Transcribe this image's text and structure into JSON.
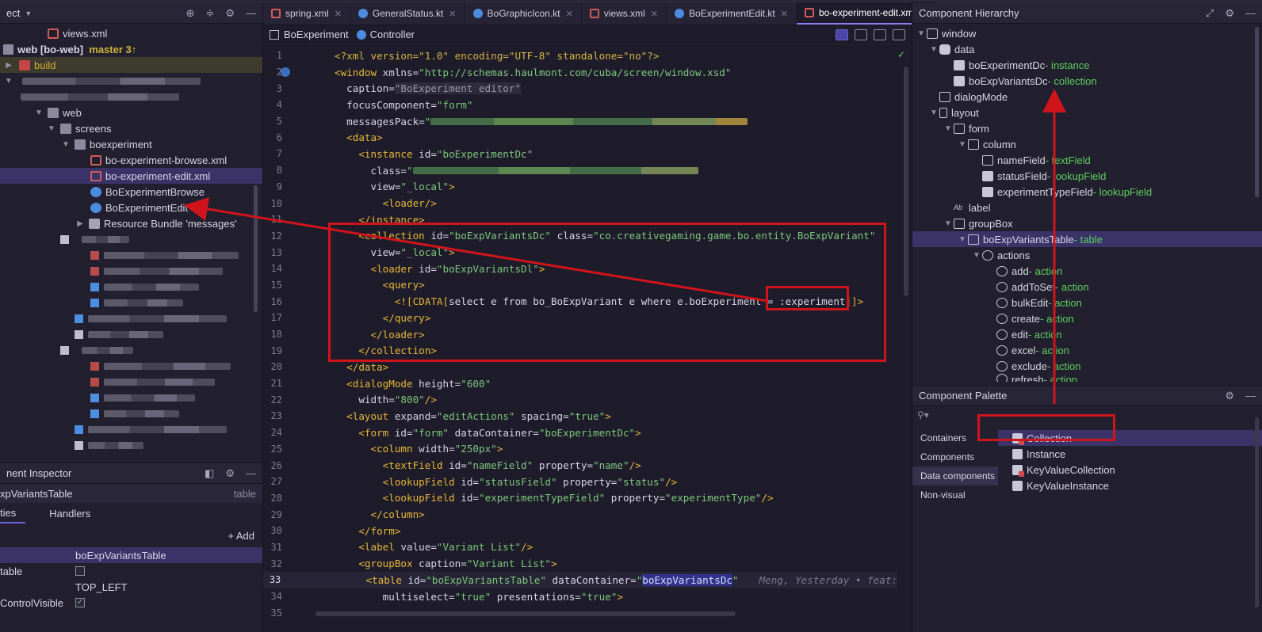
{
  "project": {
    "title": "ect",
    "items": [
      {
        "label": "views.xml",
        "type": "xml"
      },
      {
        "label": "web [bo-web]",
        "branch": "master 3↑"
      },
      {
        "label": "build"
      },
      {
        "label": "web"
      },
      {
        "label": "screens"
      },
      {
        "label": "boexperiment"
      },
      {
        "label": "bo-experiment-browse.xml"
      },
      {
        "label": "bo-experiment-edit.xml"
      },
      {
        "label": "BoExperimentBrowse"
      },
      {
        "label": "BoExperimentEdit"
      },
      {
        "label": "Resource Bundle 'messages'"
      }
    ]
  },
  "inspector": {
    "title": "nent Inspector",
    "component": "xpVariantsTable",
    "component_type": "table",
    "tabs": [
      "ties",
      "Handlers"
    ],
    "add_label": "+ Add",
    "props": [
      {
        "key": "",
        "value": "boExpVariantsTable"
      },
      {
        "key": "table",
        "value": ""
      },
      {
        "key": "",
        "value": "TOP_LEFT"
      },
      {
        "key": "ControlVisible",
        "value": ""
      }
    ]
  },
  "editor": {
    "tabs": [
      {
        "label": "spring.xml",
        "color": "#d05c5c"
      },
      {
        "label": "GeneralStatus.kt",
        "color": "#4d8be0"
      },
      {
        "label": "BoGraphicIcon.kt",
        "color": "#4d8be0"
      },
      {
        "label": "views.xml",
        "color": "#d05c5c"
      },
      {
        "label": "BoExperimentEdit.kt",
        "color": "#4d8be0"
      },
      {
        "label": "bo-experiment-edit.xml",
        "color": "#d05c5c"
      }
    ],
    "breadcrumb": {
      "screen": "BoExperiment",
      "controller": "Controller"
    },
    "annotation": "Meng, Yesterday • feat:",
    "highlight_word": "boExpVariantsDc",
    "lines": [
      {
        "n": "1"
      },
      {
        "n": "2"
      },
      {
        "n": "3"
      },
      {
        "n": "4"
      },
      {
        "n": "5"
      },
      {
        "n": "6"
      },
      {
        "n": "7"
      },
      {
        "n": "8"
      },
      {
        "n": "9"
      },
      {
        "n": "10"
      },
      {
        "n": "11"
      },
      {
        "n": "12"
      },
      {
        "n": "13"
      },
      {
        "n": "14"
      },
      {
        "n": "15"
      },
      {
        "n": "16"
      },
      {
        "n": "17"
      },
      {
        "n": "18"
      },
      {
        "n": "19"
      },
      {
        "n": "20"
      },
      {
        "n": "21"
      },
      {
        "n": "22"
      },
      {
        "n": "23"
      },
      {
        "n": "24"
      },
      {
        "n": "25"
      },
      {
        "n": "26"
      },
      {
        "n": "27"
      },
      {
        "n": "28"
      },
      {
        "n": "29"
      },
      {
        "n": "30"
      },
      {
        "n": "31"
      },
      {
        "n": "32"
      },
      {
        "n": "33"
      },
      {
        "n": "34"
      },
      {
        "n": "35"
      }
    ]
  },
  "hierarchy": {
    "title": "Component Hierarchy",
    "items": [
      {
        "name": "window"
      },
      {
        "name": "data"
      },
      {
        "name": "boExperimentDc",
        "type": " - instance"
      },
      {
        "name": "boExpVariantsDc",
        "type": " - collection"
      },
      {
        "name": "dialogMode"
      },
      {
        "name": "layout"
      },
      {
        "name": "form"
      },
      {
        "name": "column"
      },
      {
        "name": "nameField",
        "type": " - textField"
      },
      {
        "name": "statusField",
        "type": " - lookupField"
      },
      {
        "name": "experimentTypeField",
        "type": " - lookupField"
      },
      {
        "name": "label"
      },
      {
        "name": "groupBox"
      },
      {
        "name": "boExpVariantsTable",
        "type": " - table"
      },
      {
        "name": "actions"
      },
      {
        "name": "add",
        "type": " - action"
      },
      {
        "name": "addToSet",
        "type": " - action"
      },
      {
        "name": "bulkEdit",
        "type": " - action"
      },
      {
        "name": "create",
        "type": " - action"
      },
      {
        "name": "edit",
        "type": " - action"
      },
      {
        "name": "excel",
        "type": " - action"
      },
      {
        "name": "exclude",
        "type": " - action"
      },
      {
        "name": "refresh",
        "type": " - action"
      }
    ]
  },
  "palette": {
    "title": "Component Palette",
    "categories": [
      "Containers",
      "Components",
      "Data components",
      "Non-visual"
    ],
    "items": [
      "Collection",
      "Instance",
      "KeyValueCollection",
      "KeyValueInstance"
    ]
  }
}
